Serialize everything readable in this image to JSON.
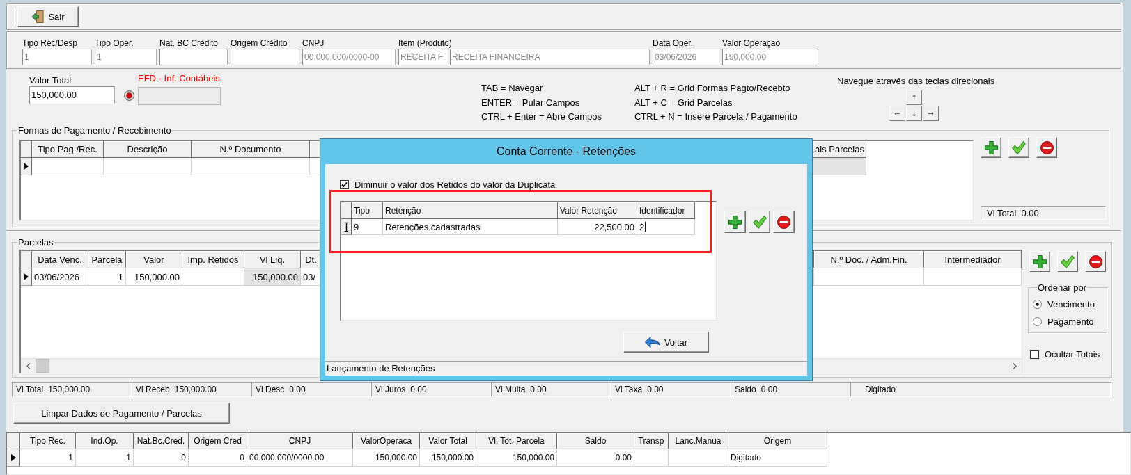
{
  "toolbar": {
    "exit_button": "Sair"
  },
  "operation_fields": [
    {
      "label": "Tipo Rec/Desp",
      "value": "1",
      "disabled": true
    },
    {
      "label": "Tipo Oper.",
      "value": "1",
      "disabled": true
    },
    {
      "label": "Nat. BC Crédito"
    },
    {
      "label": "Origem Crédito"
    },
    {
      "label": "CNPJ",
      "value": "00.000.000/0000-00",
      "disabled": true
    },
    {
      "label": "Item (Produto)",
      "value": "RECEITA F",
      "description": "RECEITA FINANCEIRA",
      "disabled": true
    },
    {
      "label": "Data Oper.",
      "value": "03/06/2026",
      "disabled": true
    },
    {
      "label": "Valor Operação",
      "value": "150,000.00",
      "disabled": true
    }
  ],
  "total_value": {
    "label": "Valor Total",
    "value": "150,000.00"
  },
  "efd": {
    "label": "EFD - Inf. Contábeis",
    "disabled": true
  },
  "shortcut_columns": [
    [
      "TAB = Navegar",
      "ENTER = Pular Campos",
      "CTRL + Enter = Abre Campos"
    ],
    [
      "ALT + R = Grid Formas Pagto/Recebto",
      "ALT + C = Grid Parcelas",
      "CTRL + N = Insere Parcela / Pagamento"
    ]
  ],
  "navigation": {
    "hint": "Navegue através das teclas direcionais",
    "keys": [
      "↑",
      "←",
      "↓",
      "→"
    ]
  },
  "payment_forms": {
    "title": "Formas de Pagamento / Recebimento",
    "columns": [
      {
        "label": "Tipo Pag./Rec.",
        "readonly": false
      },
      {
        "label": "Descrição",
        "readonly": false
      },
      {
        "label": "N.º Documento",
        "readonly": false
      },
      {
        "label": "ais Parcelas",
        "readonly": true
      }
    ],
    "rows": [
      {
        "selected": true,
        "cells": [
          null,
          null,
          null,
          null
        ]
      }
    ],
    "total": {
      "label": "Vl Total",
      "value": "0.00"
    }
  },
  "installments": {
    "title": "Parcelas",
    "columns": [
      {
        "label": "Data Venc.",
        "kind": "text",
        "readonly": false
      },
      {
        "label": "Parcela",
        "kind": "number",
        "readonly": false
      },
      {
        "label": "Valor",
        "kind": "number",
        "readonly": false
      },
      {
        "label": "Imp. Retidos",
        "readonly": false
      },
      {
        "label": "Vl Liq.",
        "kind": "number",
        "readonly": true
      },
      {
        "label": "Dt.",
        "kind": "text",
        "readonly": false
      },
      {
        "label": "N.º Doc. / Adm.Fin.",
        "readonly": false
      },
      {
        "label": "Intermediador",
        "readonly": false
      }
    ],
    "rows": [
      {
        "selected": true,
        "cells": [
          "03/06/2026",
          "1",
          "150,000.00",
          null,
          "150,000.00",
          "03/",
          null,
          null
        ]
      }
    ],
    "sort": {
      "title": "Ordenar por",
      "options": [
        {
          "label": "Vencimento",
          "selected": true
        },
        {
          "label": "Pagamento",
          "selected": false
        }
      ]
    },
    "hide_totals": {
      "label": "Ocultar Totais",
      "checked": false
    }
  },
  "totals": [
    {
      "label": "Vl Total",
      "value": "150,000.00"
    },
    {
      "label": "Vl Receb",
      "value": "150,000.00"
    },
    {
      "label": "Vl Desc",
      "value": "0.00"
    },
    {
      "label": "Vl Juros",
      "value": "0.00"
    },
    {
      "label": "Vl Multa",
      "value": "0.00"
    },
    {
      "label": "Vl Taxa",
      "value": "0.00"
    },
    {
      "label": "Saldo",
      "value": "0.00"
    }
  ],
  "entry_status": "Digitado",
  "clear_button": "Limpar Dados de Pagamento / Parcelas",
  "summary_grid": {
    "columns": [
      {
        "label": "Tipo Rec.",
        "kind": "number"
      },
      {
        "label": "Ind.Op.",
        "kind": "number"
      },
      {
        "label": "Nat.Bc.Cred.",
        "kind": "number"
      },
      {
        "label": "Origem Cred",
        "kind": "number"
      },
      {
        "label": "CNPJ",
        "kind": "text"
      },
      {
        "label": "ValorOperaca",
        "kind": "number"
      },
      {
        "label": "Valor Total",
        "kind": "number"
      },
      {
        "label": "Vl. Tot. Parcela",
        "kind": "number"
      },
      {
        "label": "Saldo",
        "kind": "number"
      },
      {
        "label": "Transp"
      },
      {
        "label": "Lanc.Manua"
      },
      {
        "label": "Origem",
        "kind": "text"
      }
    ],
    "rows": [
      {
        "selected": true,
        "cells": [
          "1",
          "1",
          "0",
          "0",
          "00.000.000/0000-00",
          "150,000.00",
          "150,000.00",
          "150,000.00",
          "0.00",
          null,
          null,
          "Digitado"
        ]
      }
    ]
  },
  "retention_dialog": {
    "title": "Conta Corrente - Retenções",
    "deduct_option": {
      "label": "Diminuir o valor dos Retidos do valor da Duplicata",
      "checked": true
    },
    "grid": {
      "highlighted": true,
      "columns": [
        {
          "label": "Tipo",
          "kind": "text"
        },
        {
          "label": "Retenção",
          "kind": "text"
        },
        {
          "label": "Valor Retenção",
          "kind": "number"
        },
        {
          "label": "Identificador",
          "kind": "text"
        }
      ],
      "rows": [
        {
          "selected": true,
          "editing": true,
          "cells": [
            "9",
            "Retenções cadastradas",
            "22,500.00",
            "2"
          ]
        }
      ]
    },
    "back_button": "Voltar",
    "status": "Lançamento de Retenções"
  }
}
